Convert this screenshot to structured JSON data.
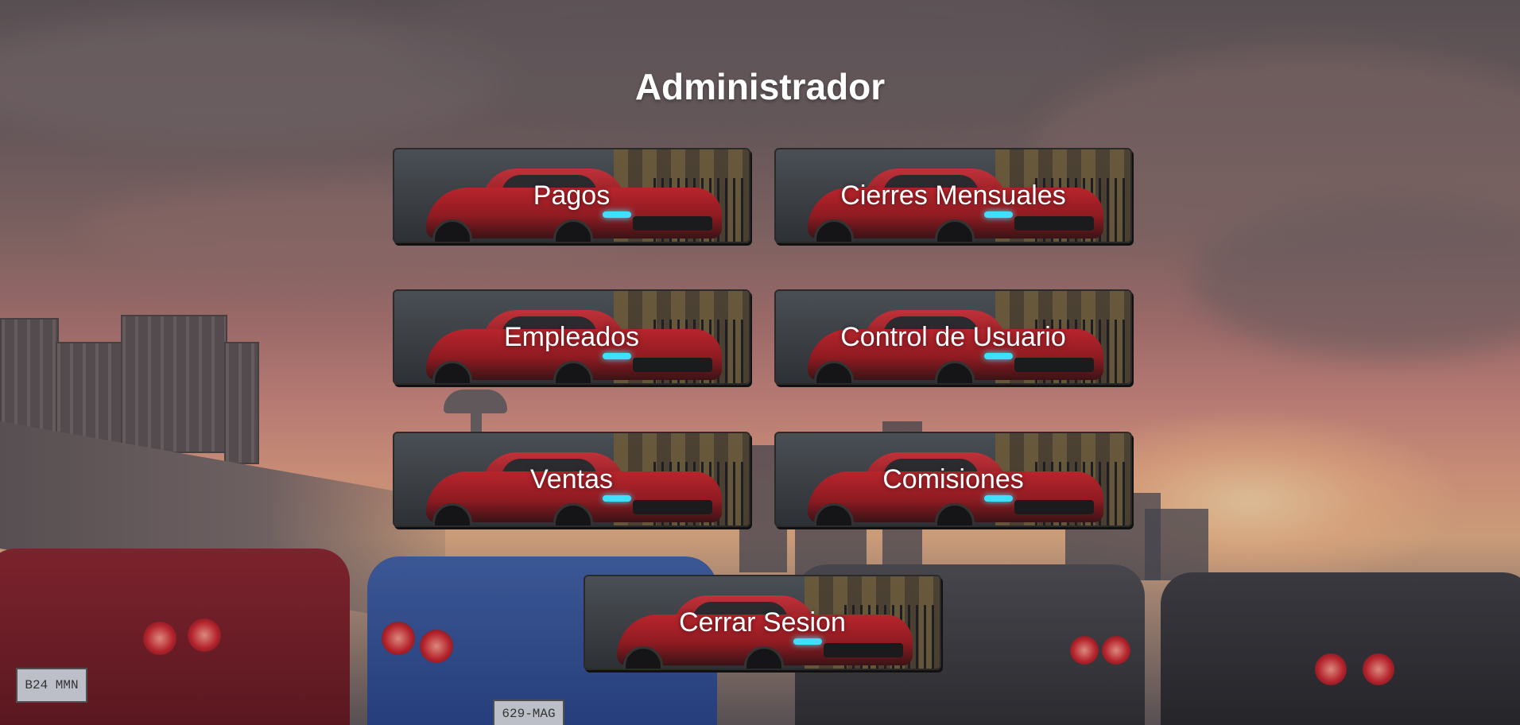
{
  "page": {
    "title": "Administrador"
  },
  "menu": {
    "items": [
      {
        "label": "Pagos"
      },
      {
        "label": "Cierres Mensuales"
      },
      {
        "label": "Empleados"
      },
      {
        "label": "Control de Usuario"
      },
      {
        "label": "Ventas"
      },
      {
        "label": "Comisiones"
      }
    ],
    "logout_label": "Cerrar Sesion"
  },
  "background": {
    "plates": [
      "B24 MMN",
      "629-MAG"
    ]
  },
  "colors": {
    "title_text": "#ffffff",
    "button_text": "#ffffff",
    "button_border": "#2a2a2a",
    "car_red": "#b8252c",
    "sky_sunset": "#e7a183"
  }
}
